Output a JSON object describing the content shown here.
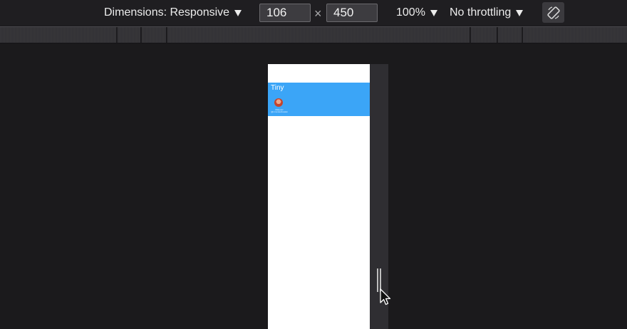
{
  "toolbar": {
    "dimensions_label": "Dimensions: Responsive",
    "width_value": "106",
    "times_symbol": "×",
    "height_value": "450",
    "zoom_label": "100%",
    "throttle_label": "No throttling",
    "rotate_icon": "rotate-icon"
  },
  "viewport": {
    "card_title": "Tiny",
    "avatar_icon": "avatar",
    "caption_line1": "Mateusz",
    "caption_line2": "@mmmkozlowski"
  },
  "colors": {
    "background": "#1b1a1c",
    "toolbar": "#1f1e21",
    "card": "#3ba5f7",
    "viewport": "#ffffff",
    "handle": "#2f2e32"
  }
}
